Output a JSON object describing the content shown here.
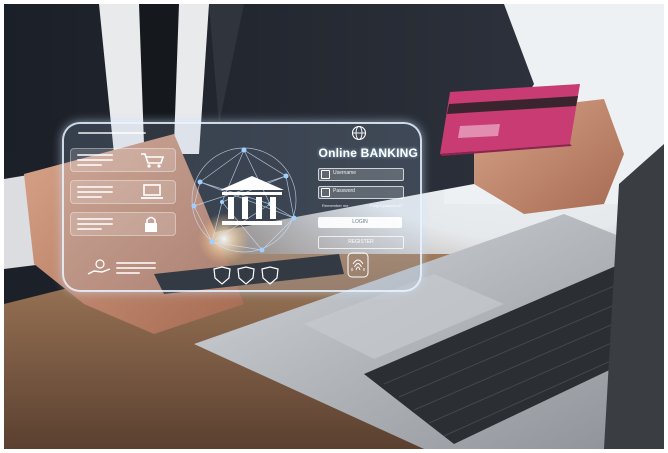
{
  "scene": {
    "colors": {
      "suit": "#22262e",
      "desk": "#8a6a50",
      "laptop": "#b9bdc2",
      "keyboard": "#2e3136",
      "card": "#c83c73",
      "hologram": "#dcecff"
    }
  },
  "hologram": {
    "title": "Online BANKING",
    "fields": [
      {
        "icon": "user-icon",
        "placeholder": "Username"
      },
      {
        "icon": "lock-icon",
        "placeholder": "Password"
      }
    ],
    "remember_text": "Remember me",
    "forgot_text": "Forgot password?",
    "login_label": "LOGIN",
    "register_label": "REGISTER",
    "side_icons": [
      "cart-icon",
      "laptop-icon",
      "lock-icon",
      "hand-money-icon"
    ],
    "center_icon": "bank-icon",
    "bottom_icons": [
      "shield-icon",
      "shield-icon",
      "shield-icon"
    ],
    "fingerprint_icon": "fingerprint-icon"
  }
}
